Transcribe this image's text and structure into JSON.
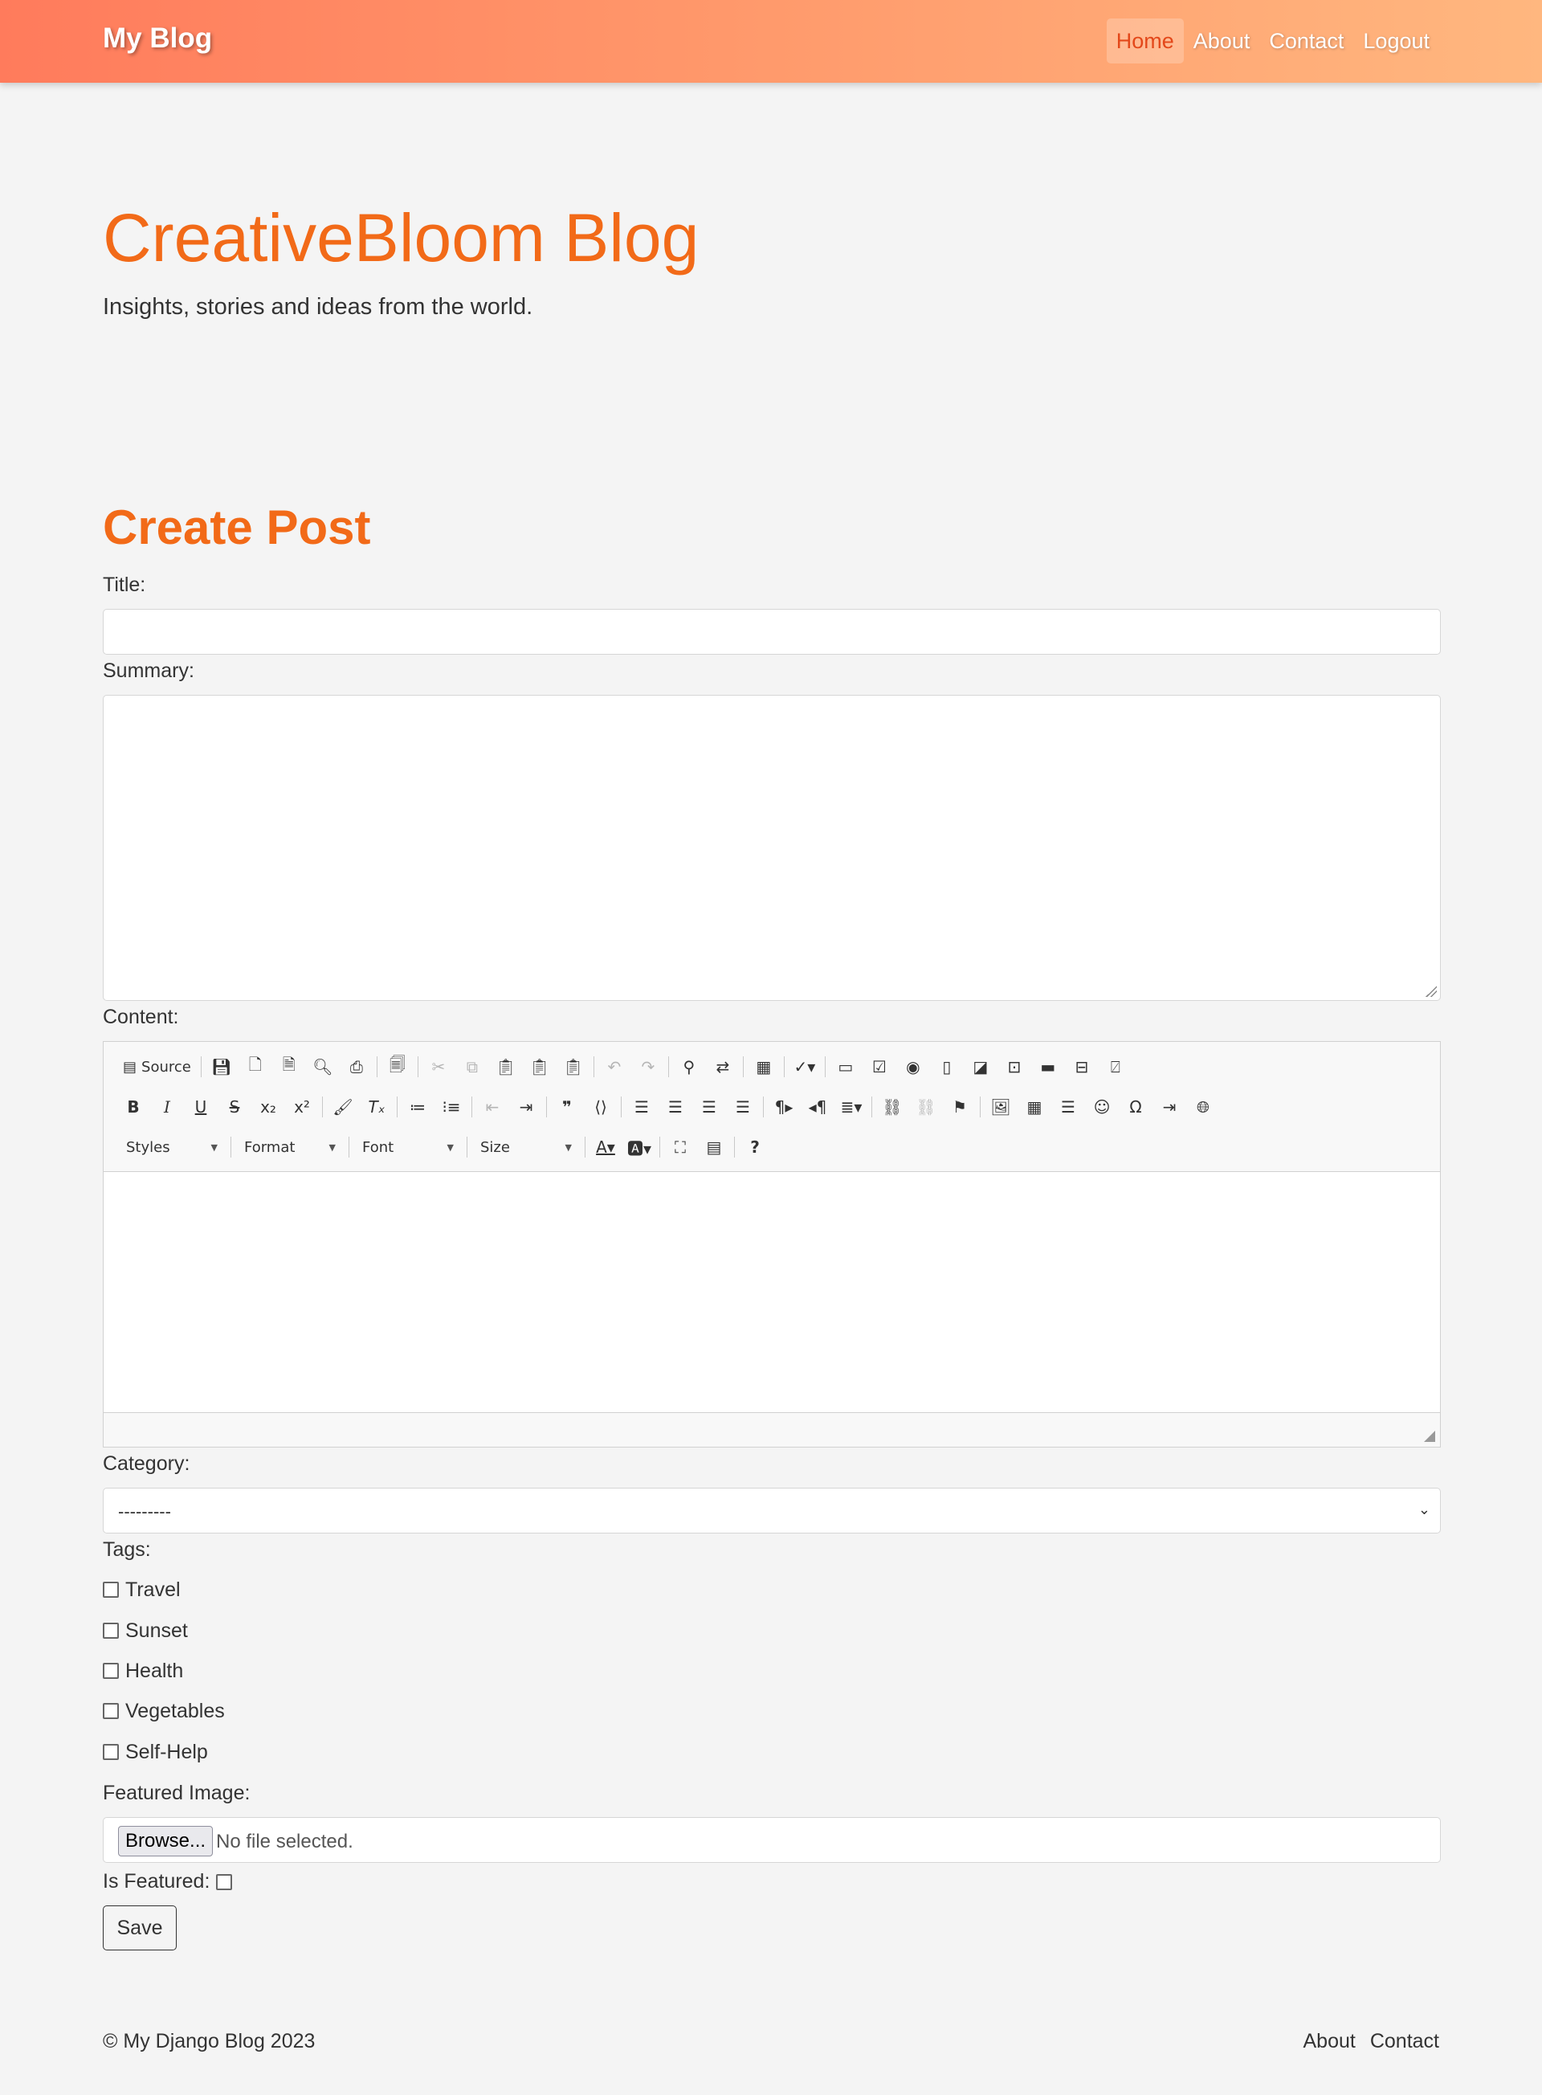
{
  "navbar": {
    "brand": "My Blog",
    "links": [
      {
        "label": "Home",
        "active": true
      },
      {
        "label": "About"
      },
      {
        "label": "Contact"
      },
      {
        "label": "Logout"
      }
    ]
  },
  "hero": {
    "title": "CreativeBloom Blog",
    "subtitle": "Insights, stories and ideas from the world."
  },
  "form": {
    "heading": "Create Post",
    "title_label": "Title:",
    "title_value": "",
    "summary_label": "Summary:",
    "summary_value": "",
    "content_label": "Content:",
    "editor": {
      "source_label": "Source",
      "styles_label": "Styles",
      "format_label": "Format",
      "font_label": "Font",
      "size_label": "Size"
    },
    "category_label": "Category:",
    "category_selected": "---------",
    "tags_label": "Tags:",
    "tags": [
      "Travel",
      "Sunset",
      "Health",
      "Vegetables",
      "Self-Help"
    ],
    "featured_image_label": "Featured Image:",
    "browse_label": "Browse...",
    "no_file_text": "No file selected.",
    "is_featured_label": "Is Featured:",
    "save_label": "Save"
  },
  "footer": {
    "copyright": "© My Django Blog 2023",
    "links": [
      "About",
      "Contact"
    ]
  },
  "colors": {
    "accent": "#f26a18",
    "navbar_start": "#ff7b5c",
    "navbar_end": "#ffb77f",
    "background": "#f4f4f4"
  }
}
